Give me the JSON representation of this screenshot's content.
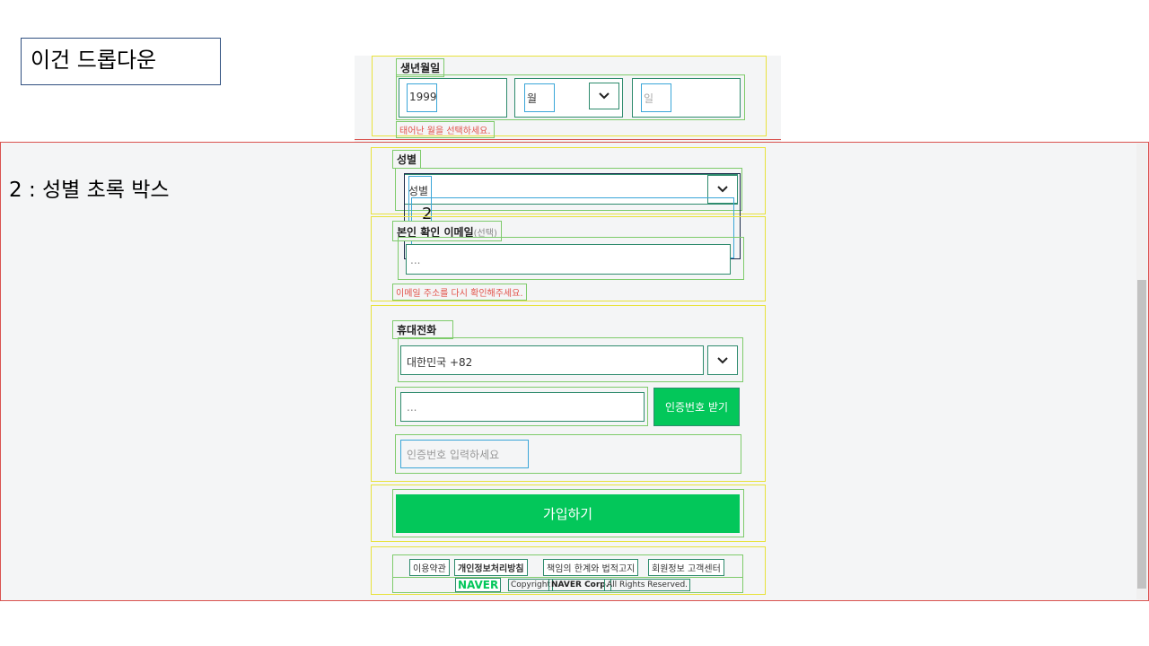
{
  "annotations": {
    "dropdown_note": "이건 드롭다운",
    "gender_note": "2 : 성별 초록 박스",
    "marker": "2"
  },
  "birthday": {
    "label": "생년월일",
    "year_value": "1999",
    "month_value": "월",
    "day_placeholder": "일",
    "error": "태어난 월을 선택하세요."
  },
  "gender": {
    "label": "성별",
    "value": "성별"
  },
  "email": {
    "label": "본인 확인 이메일",
    "label_suffix": "(선택)",
    "value": "...",
    "error": "이메일 주소를 다시 확인해주세요."
  },
  "phone": {
    "label": "휴대전화",
    "country": "대한민국 +82",
    "number_value": "...",
    "request_button": "인증번호 받기",
    "code_placeholder": "인증번호 입력하세요"
  },
  "submit": {
    "label": "가입하기"
  },
  "footer": {
    "links": [
      "이용약관",
      "개인정보처리방침",
      "책임의 한계와 법적고지",
      "회원정보 고객센터"
    ],
    "brand": "NAVER",
    "copyright": "Copyright",
    "corp": "NAVER Corp.",
    "rights": "All Rights Reserved."
  },
  "colors": {
    "accent_green": "#03c75a",
    "error_red": "#e2524a",
    "frame_red": "#d9534f",
    "outline_yellow": "#e8e23c"
  },
  "icons": [
    "chevron-down-icon"
  ]
}
